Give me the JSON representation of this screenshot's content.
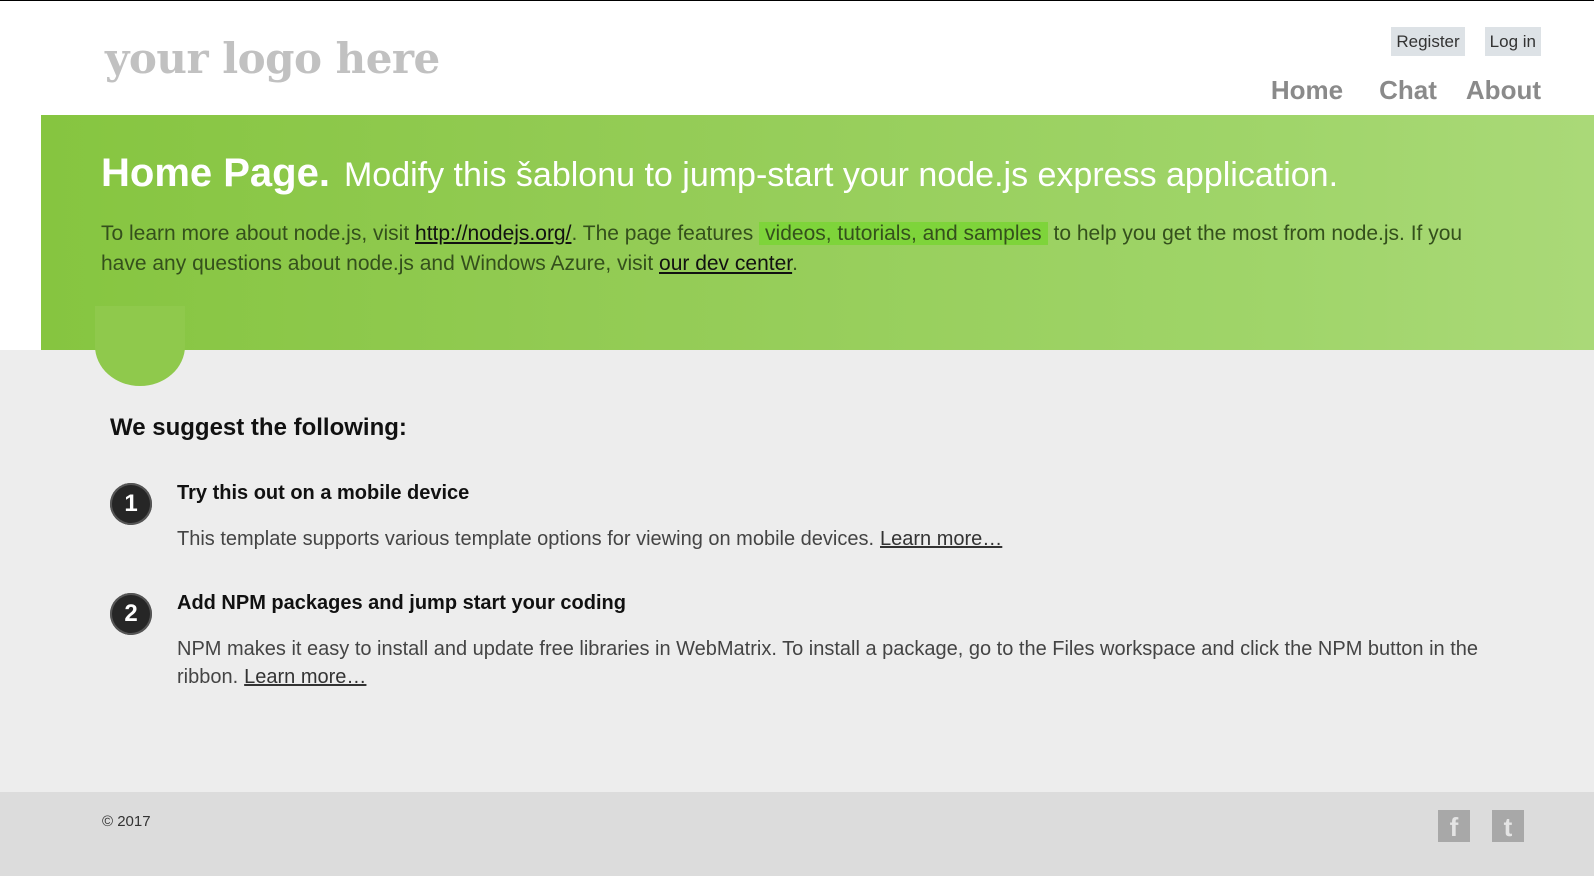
{
  "header": {
    "logo": "your logo here",
    "auth": {
      "register": "Register",
      "login": "Log in"
    },
    "nav": [
      "Home",
      "Chat",
      "About"
    ]
  },
  "hero": {
    "title_strong": "Home Page.",
    "title_rest": "Modify this šablonu to jump-start your node.js express application.",
    "text_1": "To learn more about node.js, visit",
    "link_1": "http://nodejs.org/",
    "text_2": ". The page features",
    "mark": "videos, tutorials, and samples",
    "text_3": "to help you get the most from node.js. If you have any questions about node.js and Windows Azure, visit",
    "link_2": "our dev center",
    "text_4": "."
  },
  "content": {
    "heading": "We suggest the following:",
    "steps": [
      {
        "number": "1",
        "title": "Try this out on a mobile device",
        "text": "This template supports various template options for viewing on mobile devices.",
        "link": "Learn more…"
      },
      {
        "number": "2",
        "title": "Add NPM packages and jump start your coding",
        "text": "NPM makes it easy to install and update free libraries in WebMatrix. To install a package, go to the Files workspace and click the NPM button in the ribbon.",
        "link": "Learn more…"
      }
    ]
  },
  "footer": {
    "copyright": "© 2017",
    "social": [
      {
        "icon": "facebook-icon",
        "glyph": "f"
      },
      {
        "icon": "twitter-icon",
        "glyph": "t"
      }
    ]
  },
  "colors": {
    "hero_green": "#86c540",
    "content_bg": "#ededed",
    "footer_bg": "#dcdcdc",
    "logo_gray": "#c1c1c1"
  }
}
